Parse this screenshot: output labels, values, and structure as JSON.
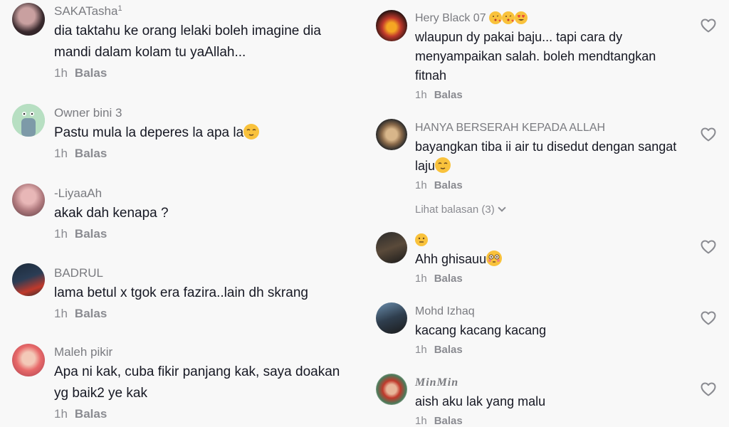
{
  "left_comments": [
    {
      "username": "SAKATasha",
      "username_sup": "1",
      "text": "dia taktahu ke orang lelaki boleh imagine dia mandi dalam kolam tu yaAllah...",
      "time": "1h",
      "reply": "Balas"
    },
    {
      "username": "Owner bini 3",
      "text": "Pastu mula la deperes la apa la",
      "time": "1h",
      "reply": "Balas"
    },
    {
      "username": "-LiyaaAh",
      "text": "akak dah kenapa ?",
      "time": "1h",
      "reply": "Balas"
    },
    {
      "username": "BADRUL",
      "text": "lama betul x tgok era fazira..lain dh skrang",
      "time": "1h",
      "reply": "Balas"
    },
    {
      "username": "Maleh pikir",
      "text": "Apa ni kak, cuba fikir panjang kak, saya doakan yg baik2 ye kak",
      "time": "1h",
      "reply": "Balas"
    }
  ],
  "right_comments": [
    {
      "username": "Hery Black 07",
      "text": "wlaupun dy pakai baju... tapi cara dy menyampaikan salah. boleh mendtangkan fitnah",
      "time": "1h",
      "reply": "Balas"
    },
    {
      "username": "HANYA BERSERAH KEPADA ALLAH",
      "text": "bayangkan tiba ii air tu disedut dengan sangat laju",
      "time": "1h",
      "reply": "Balas",
      "view_replies": "Lihat balasan (3)"
    },
    {
      "username": "",
      "text": "Ahh ghisauu",
      "time": "1h",
      "reply": "Balas"
    },
    {
      "username": "Mohd Izhaq",
      "text": "kacang kacang kacang",
      "time": "1h",
      "reply": "Balas"
    },
    {
      "username": "MinMin",
      "text": "aish aku lak yang malu",
      "time": "1h",
      "reply": "Balas"
    }
  ],
  "icons": {
    "like": "heart-outline-icon",
    "expand": "chevron-down-icon",
    "emoji_relieved": "relieved-face-emoji",
    "emoji_flushed": "flushed-face-emoji",
    "emoji_neutral": "neutral-face-emoji",
    "emoji_kiss": "face-blowing-kiss-emoji",
    "emoji_heart_eyes": "heart-eyes-emoji"
  },
  "colors": {
    "background": "#f8f8f8",
    "text_primary": "#161823",
    "text_secondary": "#8a8b91",
    "emoji_yellow": "#f9c23c"
  }
}
